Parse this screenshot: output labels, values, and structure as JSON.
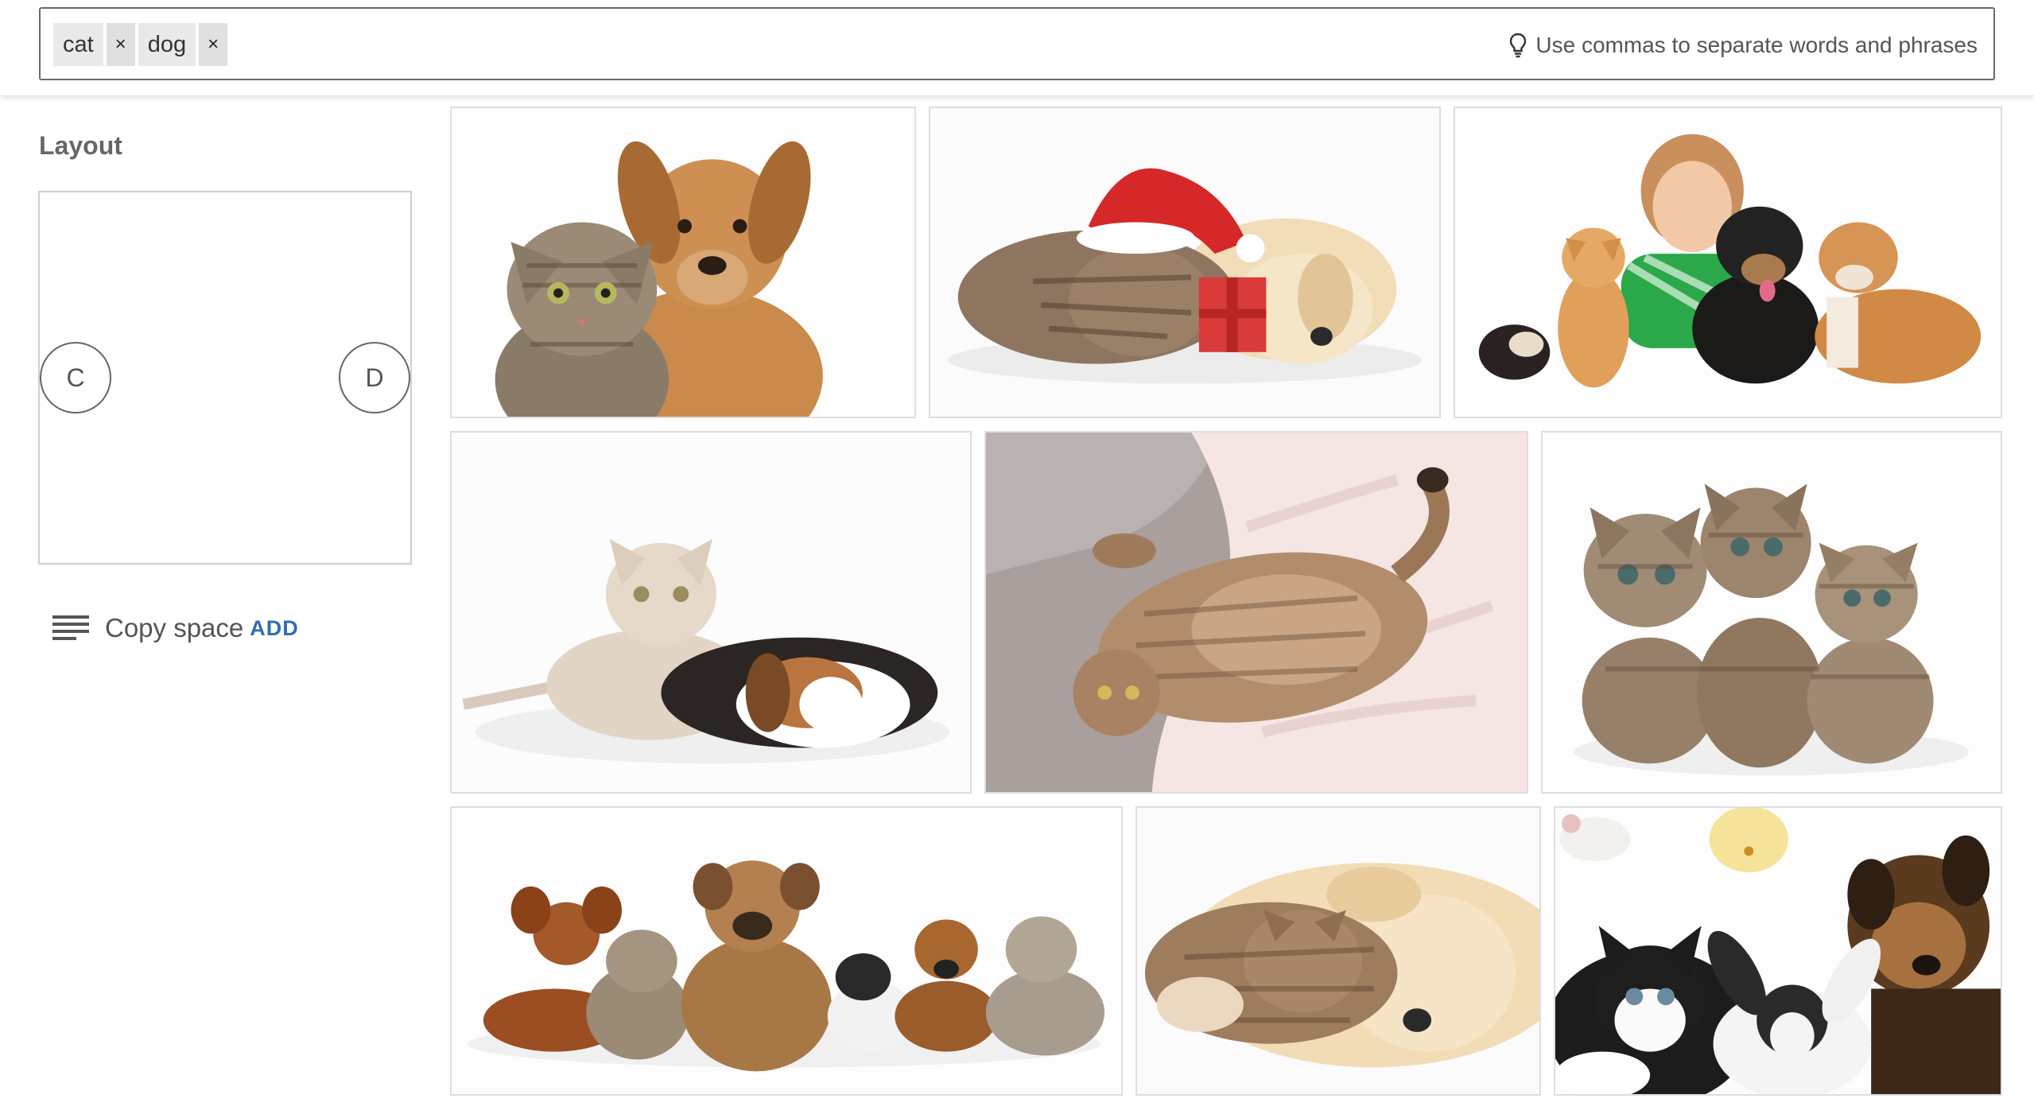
{
  "search": {
    "tags": [
      {
        "label": "cat",
        "remove": "×"
      },
      {
        "label": "dog",
        "remove": "×"
      }
    ],
    "placeholder": "",
    "hint": "Use commas to separate words and phrases",
    "hint_icon": "lightbulb-icon"
  },
  "sidebar": {
    "layout_title": "Layout",
    "handles": {
      "left": "C",
      "right": "D"
    },
    "copy_space": {
      "icon": "text-align-icon",
      "label": "Copy space",
      "action": "ADD"
    }
  },
  "colors": {
    "accent": "#2f6fb1",
    "tag_bg": "#e9e9e9",
    "border": "#dedede",
    "text": "#555555"
  },
  "results": [
    {
      "subject": "kitten and puppy sitting"
    },
    {
      "subject": "kitten and puppy sleeping with santa hat and gift"
    },
    {
      "subject": "girl with kittens, puppies and guinea pig"
    },
    {
      "subject": "kitten lying with sleeping basset puppy"
    },
    {
      "subject": "cat lying on its back on blanket"
    },
    {
      "subject": "three tabby kittens"
    },
    {
      "subject": "row of dogs and cats"
    },
    {
      "subject": "kitten sleeping on puppy"
    },
    {
      "subject": "kitten, puppy, rabbit, rat and chick"
    }
  ]
}
